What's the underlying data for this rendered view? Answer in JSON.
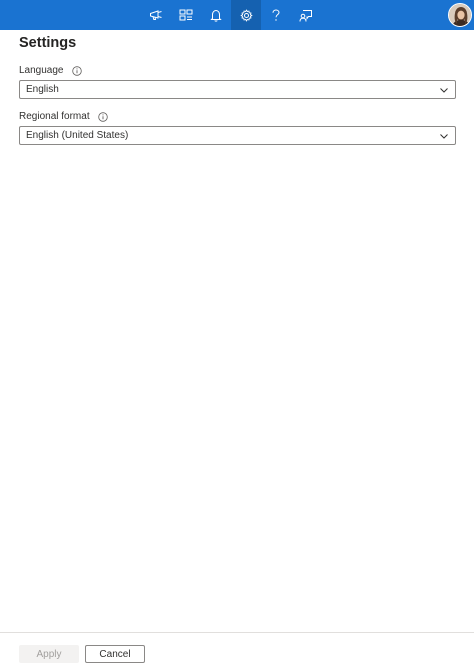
{
  "header": {
    "accent_color": "#1a73d1",
    "icons": [
      {
        "name": "megaphone-icon",
        "label": "What's new"
      },
      {
        "name": "directory-icon",
        "label": "Directories + subscriptions"
      },
      {
        "name": "bell-icon",
        "label": "Notifications"
      },
      {
        "name": "gear-icon",
        "label": "Settings",
        "active": true
      },
      {
        "name": "question-icon",
        "label": "Help"
      },
      {
        "name": "feedback-icon",
        "label": "Feedback"
      }
    ]
  },
  "page": {
    "title": "Settings"
  },
  "language": {
    "label": "Language",
    "value": "English"
  },
  "regional_format": {
    "label": "Regional format",
    "value": "English (United States)"
  },
  "footer": {
    "apply_label": "Apply",
    "cancel_label": "Cancel"
  }
}
